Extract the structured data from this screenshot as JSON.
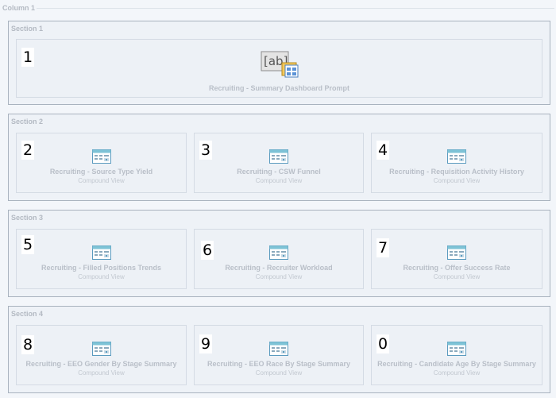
{
  "column": {
    "label": "Column 1"
  },
  "sections": [
    {
      "title": "Section 1",
      "views": [
        {
          "number": "1",
          "title": "Recruiting - Summary Dashboard Prompt",
          "subtitle": "",
          "icon": "prompt-icon"
        }
      ]
    },
    {
      "title": "Section 2",
      "views": [
        {
          "number": "2",
          "title": "Recruiting - Source Type Yield",
          "subtitle": "Compound View",
          "icon": "compound-view-icon"
        },
        {
          "number": "3",
          "title": "Recruiting - CSW Funnel",
          "subtitle": "Compound View",
          "icon": "compound-view-icon"
        },
        {
          "number": "4",
          "title": "Recruiting - Requisition Activity History",
          "subtitle": "Compound View",
          "icon": "compound-view-icon"
        }
      ]
    },
    {
      "title": "Section 3",
      "views": [
        {
          "number": "5",
          "title": "Recruiting - Filled Positions Trends",
          "subtitle": "Compound View",
          "icon": "compound-view-icon"
        },
        {
          "number": "6",
          "title": "Recruiting - Recruiter Workload",
          "subtitle": "Compound View",
          "icon": "compound-view-icon"
        },
        {
          "number": "7",
          "title": "Recruiting - Offer Success Rate",
          "subtitle": "Compound View",
          "icon": "compound-view-icon"
        }
      ]
    },
    {
      "title": "Section 4",
      "views": [
        {
          "number": "8",
          "title": "Recruiting - EEO Gender By Stage Summary",
          "subtitle": "Compound View",
          "icon": "compound-view-icon"
        },
        {
          "number": "9",
          "title": "Recruiting - EEO Race By Stage Summary",
          "subtitle": "Compound View",
          "icon": "compound-view-icon"
        },
        {
          "number": "0",
          "title": "Recruiting - Candidate Age By Stage Summary",
          "subtitle": "Compound View",
          "icon": "compound-view-icon"
        }
      ]
    }
  ]
}
